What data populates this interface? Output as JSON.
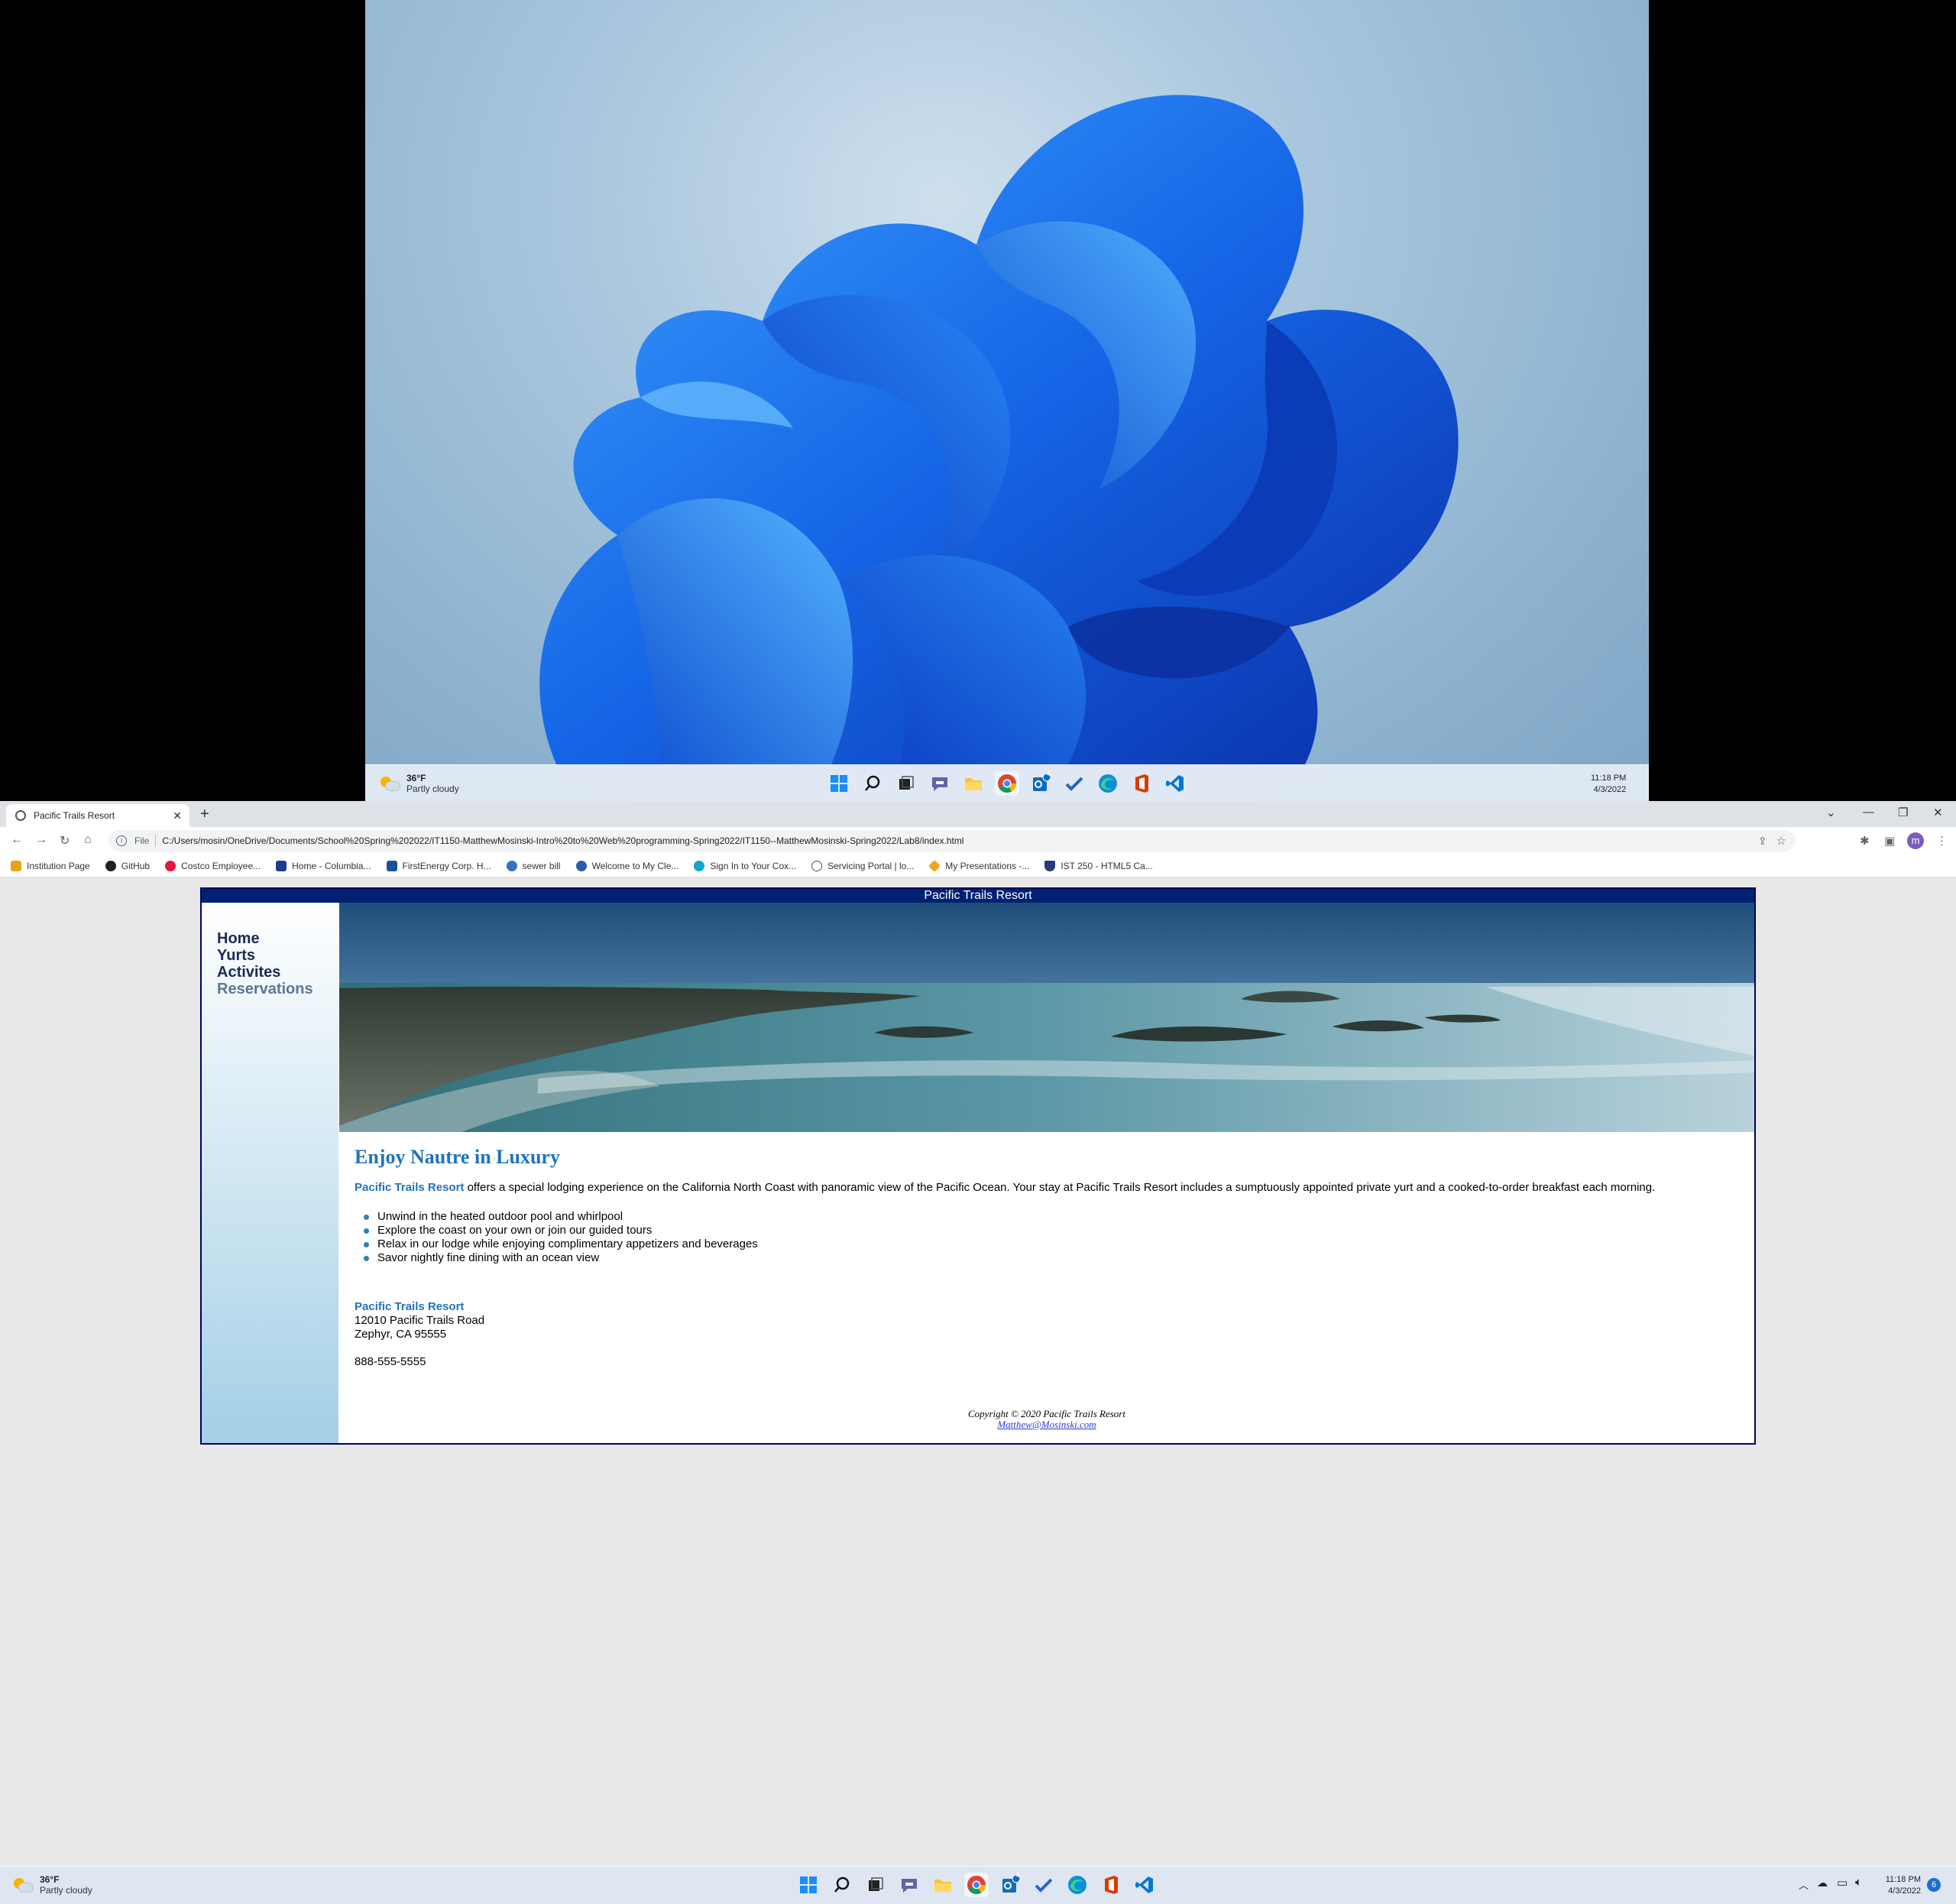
{
  "top_taskbar": {
    "weather_temp": "36°F",
    "weather_desc": "Partly cloudy",
    "time": "11:18 PM",
    "date": "4/3/2022",
    "mail_badge": "4"
  },
  "browser": {
    "tab_title": "Pacific Trails Resort",
    "new_tab_label": "+",
    "scheme_label": "File",
    "url": "C:/Users/mosin/OneDrive/Documents/School%20Spring%202022/IT1150-MatthewMosinski-Intro%20to%20Web%20programming-Spring2022/IT1150--MatthewMosinski-Spring2022/Lab8/index.html",
    "avatar_letter": "m",
    "bookmarks": [
      {
        "label": "Institution Page",
        "color": "#e8a21a"
      },
      {
        "label": "GitHub",
        "color": "#222222"
      },
      {
        "label": "Costco Employee...",
        "color": "#e31837"
      },
      {
        "label": "Home - Columbia...",
        "color": "#1a3e8c"
      },
      {
        "label": "FirstEnergy Corp. H...",
        "color": "#1c4fa0"
      },
      {
        "label": "sewer bill",
        "color": "#3a6fc4"
      },
      {
        "label": "Welcome to My Cle...",
        "color": "#2a5db0"
      },
      {
        "label": "Sign In to Your Cox...",
        "color": "#11a7c9"
      },
      {
        "label": "Servicing Portal | lo...",
        "color": "#555555"
      },
      {
        "label": "My Presentations -...",
        "color": "#f4a31b"
      },
      {
        "label": "IST 250 - HTML5 Ca...",
        "color": "#2a3a7c"
      }
    ]
  },
  "site": {
    "header": "Pacific Trails Resort",
    "nav": [
      "Home",
      "Yurts",
      "Activites",
      "Reservations"
    ],
    "heading": "Enjoy Nautre in Luxury",
    "intro_name": "Pacific Trails Resort",
    "intro_text": " offers a special lodging experience on the California North Coast with panoramic view of the Pacific Ocean. Your stay at Pacific Trails Resort includes a sumptuously appointed private yurt and a cooked-to-order breakfast each morning.",
    "features": [
      "Unwind in the heated outdoor pool and whirlpool",
      "Explore the coast on your own or join our guided tours",
      "Relax in our lodge while enjoying complimentary appetizers and beverages",
      "Savor nightly fine dining with an ocean view"
    ],
    "address_name": "Pacific Trails Resort",
    "address_line1": "12010 Pacific Trails Road",
    "address_line2": "Zephyr, CA 95555",
    "phone": "888-555-5555",
    "copyright": "Copyright © 2020 Pacific Trails Resort",
    "email": "Matthew@Mosinski.com"
  },
  "bottom_taskbar": {
    "weather_temp": "36°F",
    "weather_desc": "Partly cloudy",
    "time": "11:18 PM",
    "date": "4/3/2022",
    "notification_count": "6",
    "mail_badge": "4"
  },
  "colors": {
    "site_header_bg": "#002171",
    "accent_blue": "#1e73be",
    "nav_link": "#1a2b56",
    "nav_visited": "#5a7894"
  },
  "icons": {
    "taskbar": [
      "windows-start-icon",
      "search-icon",
      "task-view-icon",
      "teams-chat-icon",
      "file-explorer-icon",
      "chrome-icon",
      "outlook-icon",
      "todo-icon",
      "edge-icon",
      "office-icon",
      "vscode-icon"
    ]
  }
}
